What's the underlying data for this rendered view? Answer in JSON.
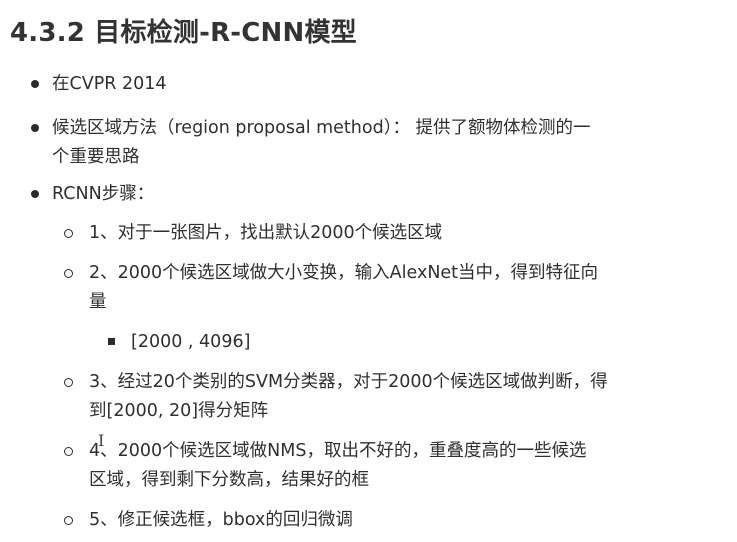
{
  "title": "4.3.2 目标检测-R-CNN模型",
  "items": [
    {
      "text": "在CVPR 2014"
    },
    {
      "text_line1": "候选区域方法（region proposal method）： 提供了额物体检测的一",
      "text_line2": "个重要思路"
    },
    {
      "text": "RCNN步骤：",
      "steps": [
        {
          "text": "1、对于一张图片，找出默认2000个候选区域"
        },
        {
          "text_line1": "2、2000个候选区域做大小变换，输入AlexNet当中，得到特征向",
          "text_line2": "量",
          "sub": [
            {
              "text": "[2000 , 4096]"
            }
          ]
        },
        {
          "text_line1": "3、经过20个类别的SVM分类器，对于2000个候选区域做判断，得",
          "text_line2": "到[2000, 20]得分矩阵"
        },
        {
          "text_line1": "4、2000个候选区域做NMS，取出不好的，重叠度高的一些候选",
          "text_line2": "区域，得到剩下分数高，结果好的框"
        },
        {
          "text": "5、修正候选框，bbox的回归微调"
        }
      ]
    }
  ],
  "cursor_glyph": "I"
}
